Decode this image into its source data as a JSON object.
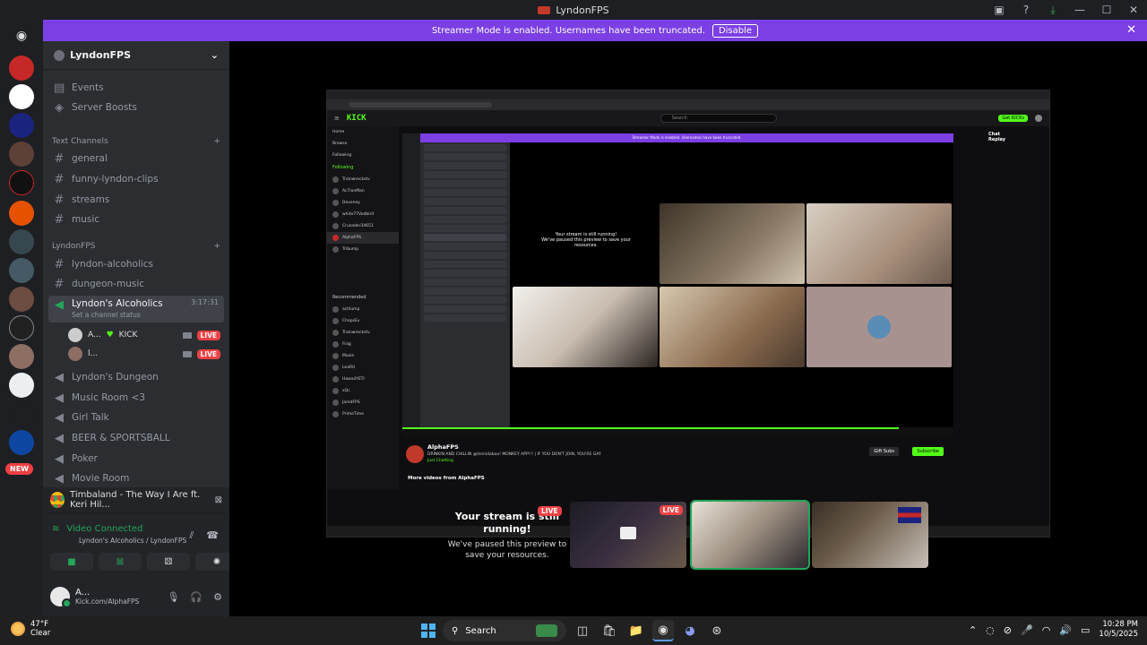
{
  "window": {
    "title": "LyndonFPS"
  },
  "banner": {
    "text": "Streamer Mode is enabled. Usernames have been truncated.",
    "disable_label": "Disable"
  },
  "guild": {
    "name": "LyndonFPS"
  },
  "nav": {
    "events": "Events",
    "boosts": "Server Boosts"
  },
  "categories": {
    "text": "Text Channels",
    "lyndon": "LyndonFPS"
  },
  "text_channels": [
    "general",
    "funny-lyndon-clips",
    "streams",
    "music"
  ],
  "lyndon_channels": [
    "lyndon-alcoholics",
    "dungeon-music"
  ],
  "active_voice": {
    "name": "Lyndon's Alcoholics",
    "timer": "3:17:31",
    "status": "Set a channel status"
  },
  "voice_users": [
    {
      "name": "A...",
      "tag": "KICK",
      "live": "LIVE"
    },
    {
      "name": "l...",
      "tag": "",
      "live": "LIVE"
    }
  ],
  "voice_channels": [
    "Lyndon's Dungeon",
    "Music Room <3",
    "Girl Talk",
    "BEER & SPORTSBALL",
    "Poker",
    "Movie Room"
  ],
  "new_badge": "NEW",
  "activity": {
    "text": "Timbaland - The Way I Are ft. Keri Hil..."
  },
  "voice_panel": {
    "status": "Video Connected",
    "channel": "Lyndon's Alcoholics / LyndonFPS"
  },
  "user": {
    "name": "A...",
    "status": "Kick.com/AlphaFPS"
  },
  "shared_screen": {
    "site_logo": "KICK",
    "search_placeholder": "Search",
    "get_kick": "Get KICKs",
    "sidebar_header": "Following",
    "sidebar_items": [
      "Home",
      "Browse",
      "Following"
    ],
    "following": [
      "Trainwreckstv",
      "Ac7ionMan",
      "Deveney",
      "white77Vodbird",
      "Crusader34651",
      "AlphaFPS",
      "Tribump"
    ],
    "recommended_header": "Recommended",
    "recommended": [
      "achlump",
      "ChopsEx",
      "Trainwreckstv",
      "Frag",
      "Moxie",
      "LeaRit",
      "HawaiiYETI",
      "xQc",
      "JaredFPS",
      "PrimeTime"
    ],
    "inner_banner": "Streamer Mode is enabled. Usernames have been truncated.",
    "paused_line1": "Your stream is still running!",
    "paused_line2": "We've paused this preview to save your resources.",
    "channel_name": "AlphaFPS",
    "stream_title": "DRINKIN AND CHILLIN @itsmidaboo! MONKEY APP!!! | IF YOU DON'T JOIN, YOU'RE GAY",
    "category": "Just Chatting",
    "gift_subs": "Gift Subs",
    "subscribe": "Subscribe",
    "more_videos": "More videos from AlphaFPS",
    "chat_replay": "Chat Replay"
  },
  "preview": {
    "title": "Your stream is still running!",
    "subtitle": "We've paused this preview to save your resources.",
    "live": "LIVE"
  },
  "taskbar": {
    "temp": "47°F",
    "weather": "Clear",
    "search": "Search",
    "time": "10:28 PM",
    "date": "10/5/2025"
  },
  "colors": {
    "accent": "#7b3fe4",
    "green": "#23a55a",
    "kick": "#53fc18",
    "live": "#ed4245"
  }
}
